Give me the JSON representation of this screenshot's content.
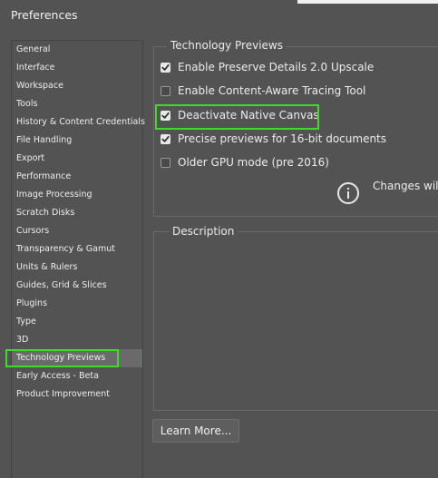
{
  "window": {
    "title": "Preferences"
  },
  "sidebar": {
    "selected": "Technology Previews",
    "items": [
      {
        "label": "General"
      },
      {
        "label": "Interface"
      },
      {
        "label": "Workspace"
      },
      {
        "label": "Tools"
      },
      {
        "label": "History & Content Credentials"
      },
      {
        "label": "File Handling"
      },
      {
        "label": "Export"
      },
      {
        "label": "Performance"
      },
      {
        "label": "Image Processing"
      },
      {
        "label": "Scratch Disks"
      },
      {
        "label": "Cursors"
      },
      {
        "label": "Transparency & Gamut"
      },
      {
        "label": "Units & Rulers"
      },
      {
        "label": "Guides, Grid & Slices"
      },
      {
        "label": "Plugins"
      },
      {
        "label": "Type"
      },
      {
        "label": "3D"
      },
      {
        "label": "Technology Previews"
      },
      {
        "label": "Early Access - Beta"
      },
      {
        "label": "Product Improvement"
      }
    ]
  },
  "tech_previews": {
    "heading": "Technology Previews",
    "options": [
      {
        "label": "Enable Preserve Details 2.0 Upscale",
        "checked": true
      },
      {
        "label": "Enable Content-Aware Tracing Tool",
        "checked": false
      },
      {
        "label": "Deactivate Native Canvas",
        "checked": true
      },
      {
        "label": "Precise previews for 16-bit documents",
        "checked": true
      },
      {
        "label": "Older GPU mode (pre 2016)",
        "checked": false
      }
    ],
    "info_text": "Changes will"
  },
  "description": {
    "heading": "Description"
  },
  "buttons": {
    "learn_more": "Learn More..."
  },
  "colors": {
    "background": "#535353",
    "highlight": "#3ddc2a",
    "selected_row": "#6a6a6a"
  }
}
